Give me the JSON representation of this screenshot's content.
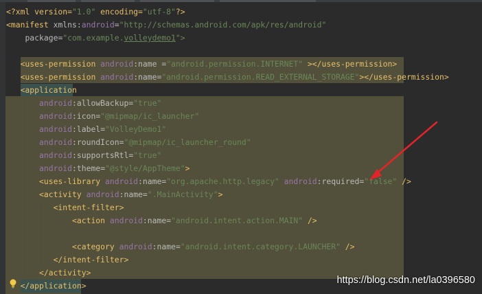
{
  "editor": {
    "language": "XML",
    "colors": {
      "bracket": "#e8bf6a",
      "namespace": "#9876aa",
      "attr": "#bababa",
      "string": "#6a8759",
      "background": "#2b2b2b",
      "highlight": "#52503a"
    }
  },
  "code": {
    "l1": {
      "t1": "<?xml version=",
      "v1": "\"1.0\"",
      "t2": " encoding=",
      "v2": "\"utf-8\"",
      "t3": "?>"
    },
    "l2": {
      "tag": "<manifest",
      "ns": " xmlns:",
      "attr": "android",
      "eq": "=",
      "val": "\"http://schemas.android.com/apk/res/android\""
    },
    "l3": {
      "attr": "package",
      "eq": "=",
      "val_a": "\"com.example.",
      "val_b": "volleydemo1",
      "val_c": "\">"
    },
    "l5": {
      "tag": "<uses-permission",
      "ns": "android",
      "colon": ":",
      "attr": "name",
      "eq": " =",
      "val": "\"android.permission.INTERNET\"",
      "close": " ></uses-permission>"
    },
    "l6": {
      "tag": "<uses-permission",
      "ns": "android",
      "colon": ":",
      "attr": "name",
      "eq": "=",
      "val": "\"android.permission.READ_EXTERNAL_STORAGE\"",
      "close": "></uses-permission>"
    },
    "l7": {
      "tag": "<application"
    },
    "l8": {
      "ns": "android",
      "attr": ":allowBackup",
      "eq": "=",
      "val": "\"true\""
    },
    "l9": {
      "ns": "android",
      "attr": ":icon",
      "eq": "=",
      "val": "\"@mipmap/ic_launcher\""
    },
    "l10": {
      "ns": "android",
      "attr": ":label",
      "eq": "=",
      "val": "\"VolleyDemo1\""
    },
    "l11": {
      "ns": "android",
      "attr": ":roundIcon",
      "eq": "=",
      "val": "\"@mipmap/ic_launcher_round\""
    },
    "l12": {
      "ns": "android",
      "attr": ":supportsRtl",
      "eq": "=",
      "val": "\"true\""
    },
    "l13": {
      "ns": "android",
      "attr": ":theme",
      "eq": "=",
      "val": "\"@style/AppTheme\"",
      "close": ">"
    },
    "l14": {
      "tag": "<uses-library",
      "ns1": " android",
      "attr1": ":name",
      "eq1": "=",
      "val1": "\"org.apache.http.legacy\"",
      "ns2": " android",
      "attr2": ":required",
      "eq2": "=",
      "val2": "\"false\"",
      "close": " />"
    },
    "l15": {
      "tag": "<activity",
      "ns": " android",
      "attr": ":name",
      "eq": "=",
      "val": "\".MainActivity\"",
      "close": ">"
    },
    "l16": {
      "tag": "<intent-filter>"
    },
    "l17": {
      "tag": "<action",
      "ns": " android",
      "attr": ":name",
      "eq": "=",
      "val": "\"android.intent.action.MAIN\"",
      "close": " />"
    },
    "l19": {
      "tag": "<category",
      "ns": " android",
      "attr": ":name",
      "eq": "=",
      "val": "\"android.intent.category.LAUNCHER\"",
      "close": " />"
    },
    "l20": {
      "tag": "</intent-filter>"
    },
    "l21": {
      "tag": "</activity>"
    },
    "l22": {
      "tag": "</application>"
    }
  },
  "icons": {
    "bulb": "lightbulb-icon",
    "arrow": "red-arrow-annotation"
  },
  "watermark": "https://blog.csdn.net/la0396580"
}
